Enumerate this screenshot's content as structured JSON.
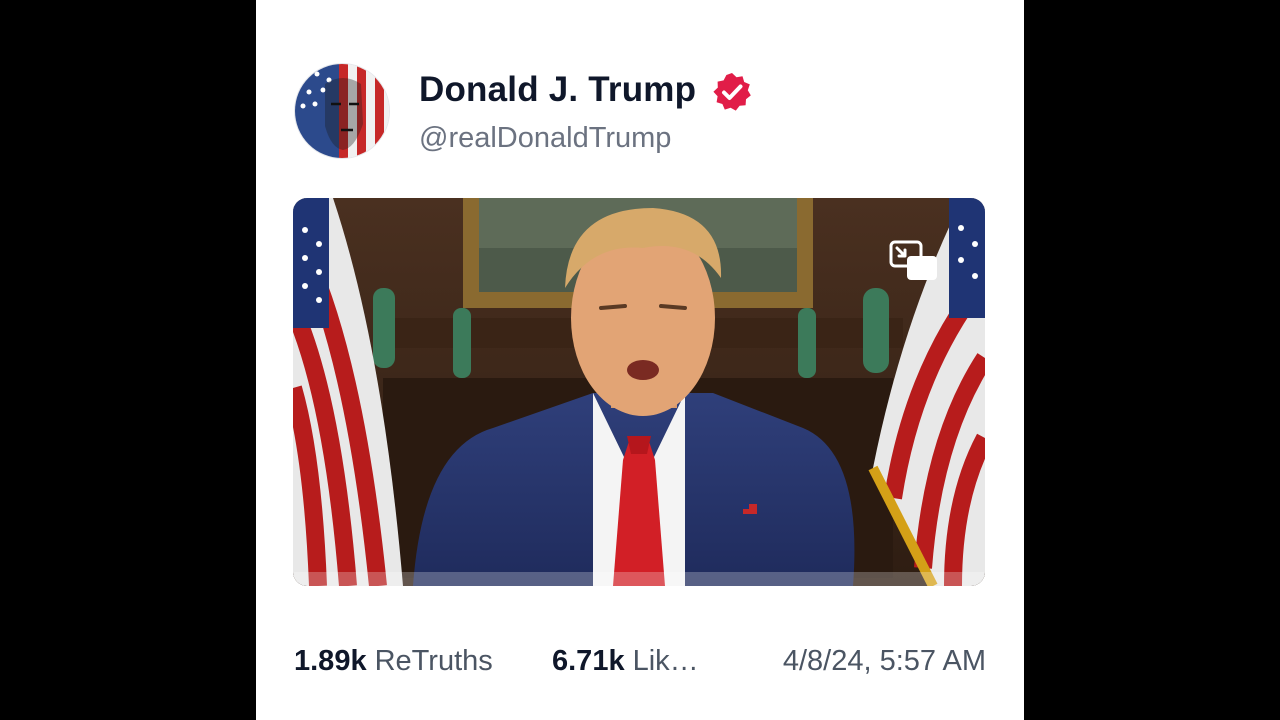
{
  "post": {
    "author": {
      "display_name": "Donald J. Trump",
      "handle": "@realDonaldTrump",
      "verified": true,
      "verified_icon": "verified-badge-icon",
      "verified_color": "#e11d48"
    },
    "media": {
      "type": "video",
      "pip_icon": "picture-in-picture-icon"
    },
    "stats": {
      "retruths_count": "1.89k",
      "retruths_label": "ReTruths",
      "likes_count": "6.71k",
      "likes_label": "Lik…",
      "timestamp": "4/8/24, 5:57 AM"
    }
  },
  "colors": {
    "page_background": "#000000",
    "card_background": "#ffffff",
    "name_text": "#0f172a",
    "muted_text": "#6b7280",
    "accent": "#e11d48"
  }
}
